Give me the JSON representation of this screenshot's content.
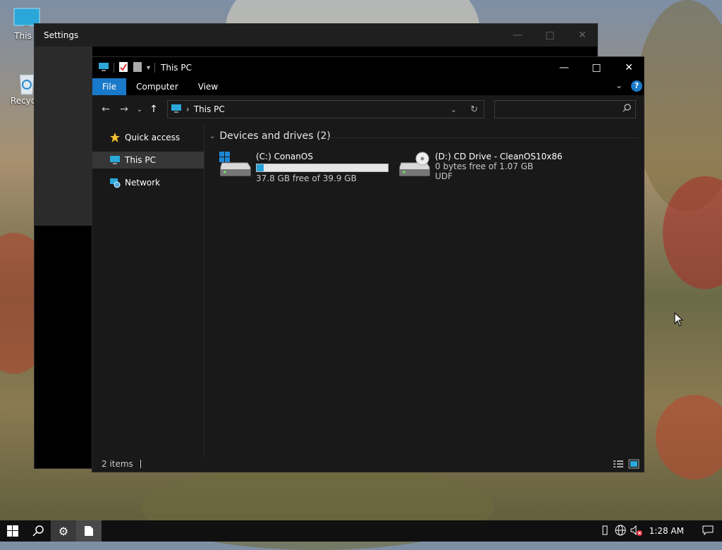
{
  "desktop": {
    "icons": [
      {
        "label": "This P"
      },
      {
        "label": "Recycle"
      }
    ]
  },
  "settings_window": {
    "title": "Settings"
  },
  "explorer": {
    "title": "This PC",
    "ribbon_tabs": [
      "File",
      "Computer",
      "View"
    ],
    "address": {
      "location": "This PC"
    },
    "search": {
      "placeholder": ""
    },
    "nav_items": [
      {
        "label": "Quick access",
        "icon": "star-icon"
      },
      {
        "label": "This PC",
        "icon": "computer-icon",
        "selected": true
      },
      {
        "label": "Network",
        "icon": "network-icon"
      }
    ],
    "group_header": "Devices and drives (2)",
    "drives": [
      {
        "label": "(C:) ConanOS",
        "free_text": "37.8 GB free of 39.9 GB",
        "used_fraction": 0.053
      },
      {
        "label": "(D:) CD Drive - CleanOS10x86",
        "free_text": "0 bytes free of 1.07 GB",
        "fs": "UDF"
      }
    ],
    "status": "2 items"
  },
  "taskbar": {
    "clock": "1:28 AM"
  },
  "colors": {
    "accent": "#1979ca",
    "bar_fill": "#26a0da",
    "window_bg": "#191919"
  }
}
